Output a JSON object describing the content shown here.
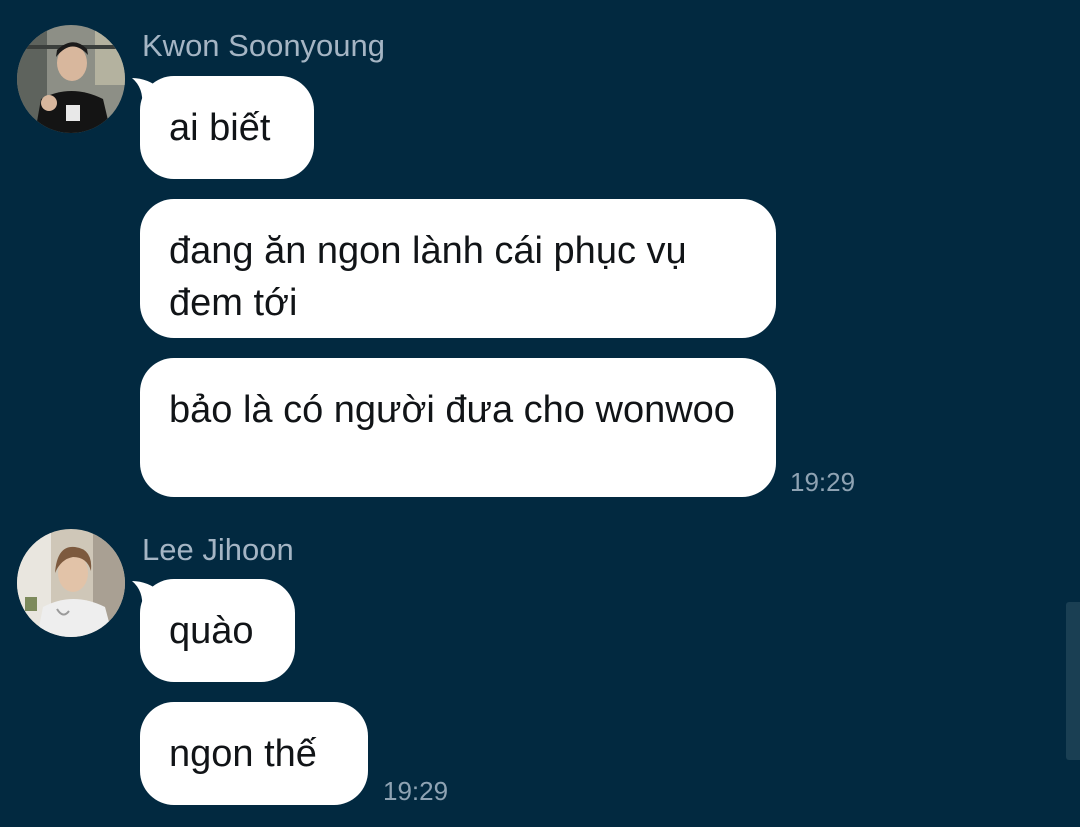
{
  "messages": [
    {
      "sender": "Kwon Soonyoung",
      "bubbles": [
        "ai biết",
        "đang ăn ngon lành cái phục vụ đem tới",
        "bảo là có người đưa cho wonwoo"
      ],
      "time": "19:29"
    },
    {
      "sender": "Lee Jihoon",
      "bubbles": [
        "quào",
        "ngon thế"
      ],
      "time": "19:29"
    }
  ],
  "avatars": {
    "soonyoung": "user-photo-avatar",
    "jihoon": "user-photo-avatar"
  },
  "colors": {
    "background": "#022940",
    "bubble": "#ffffff",
    "sender_name": "#a5b5c4",
    "timestamp": "#8fa3b3"
  }
}
